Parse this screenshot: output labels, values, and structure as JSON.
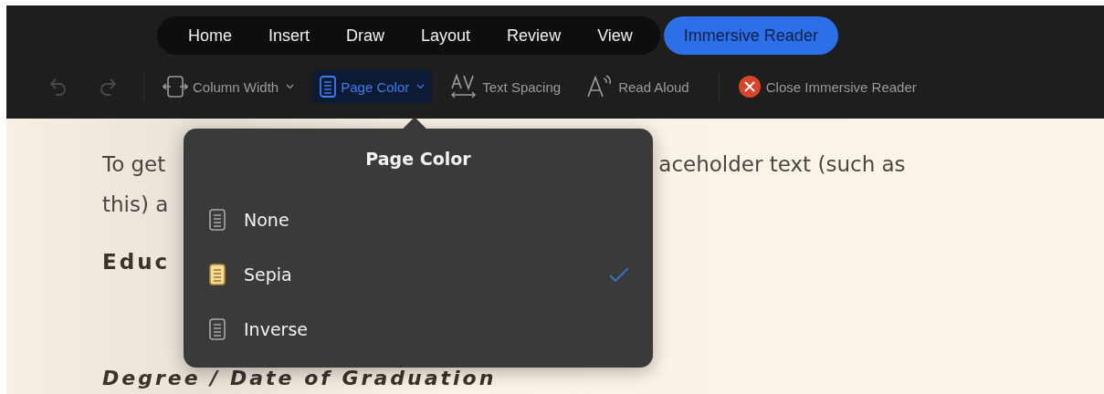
{
  "tabs": [
    {
      "label": "Home",
      "selected": false
    },
    {
      "label": "Insert",
      "selected": false
    },
    {
      "label": "Draw",
      "selected": false
    },
    {
      "label": "Layout",
      "selected": false
    },
    {
      "label": "Review",
      "selected": false
    },
    {
      "label": "View",
      "selected": false
    },
    {
      "label": "Immersive Reader",
      "selected": true
    }
  ],
  "toolbar": [
    {
      "kind": "undo",
      "disabled": true
    },
    {
      "kind": "redo",
      "disabled": true
    },
    {
      "kind": "separator"
    },
    {
      "kind": "column-width",
      "label": "Column Width",
      "dropdown": true,
      "active": false
    },
    {
      "kind": "page-color",
      "label": "Page Color",
      "dropdown": true,
      "active": true
    },
    {
      "kind": "text-spacing",
      "label": "Text Spacing",
      "dropdown": false,
      "active": false
    },
    {
      "kind": "read-aloud",
      "label": "Read Aloud",
      "dropdown": false,
      "active": false
    },
    {
      "kind": "separator"
    },
    {
      "kind": "close",
      "label": "Close Immersive Reader",
      "dropdown": false,
      "active": false
    }
  ],
  "document": {
    "lines": [
      {
        "kind": "body",
        "parts": [
          "To get",
          "aceholder text (such as"
        ]
      },
      {
        "kind": "body",
        "parts": [
          "this) a"
        ]
      },
      {
        "kind": "heading",
        "parts": [
          "Educ"
        ]
      },
      {
        "kind": "subheading",
        "parts": [
          "Degree / Date of Graduation"
        ]
      }
    ]
  },
  "popover": {
    "title": "Page Color",
    "options": [
      {
        "label": "None",
        "kind": "none",
        "selected": false
      },
      {
        "label": "Sepia",
        "kind": "sepia",
        "selected": true
      },
      {
        "label": "Inverse",
        "kind": "inverse",
        "selected": false
      }
    ]
  }
}
